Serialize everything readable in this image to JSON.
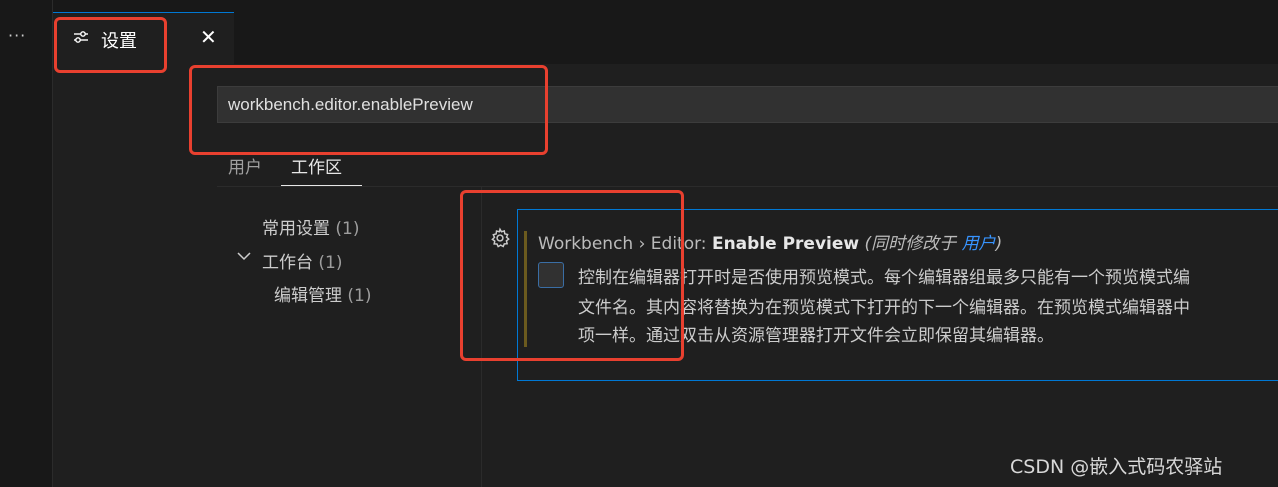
{
  "toolbar": {
    "more_label": "···"
  },
  "tab": {
    "label": "设置",
    "close_glyph": "✕",
    "icon": "settings-sliders-icon"
  },
  "search": {
    "value": "workbench.editor.enablePreview"
  },
  "scope_tabs": {
    "user": "用户",
    "workspace": "工作区"
  },
  "toc": {
    "items": [
      {
        "label": "常用设置",
        "count": "(1)"
      },
      {
        "label": "工作台",
        "count": "(1)"
      },
      {
        "label": "编辑管理",
        "count": "(1)"
      }
    ]
  },
  "setting": {
    "category": "Workbench › Editor: ",
    "key": "Enable Preview",
    "modified_prefix": "(同时修改于 ",
    "modified_link": "用户",
    "modified_suffix": ")",
    "checked": false,
    "description_lines": [
      "控制在编辑器打开时是否使用预览模式。每个编辑器组最多只能有一个预览模式编",
      "文件名。其内容将替换为在预览模式下打开的下一个编辑器。在预览模式编辑器中",
      "项一样。通过双击从资源管理器打开文件会立即保留其编辑器。"
    ]
  },
  "watermark": "CSDN @嵌入式码农驿站",
  "colors": {
    "accent": "#0078d4",
    "annotation": "#e8402f",
    "link": "#3794ff"
  }
}
